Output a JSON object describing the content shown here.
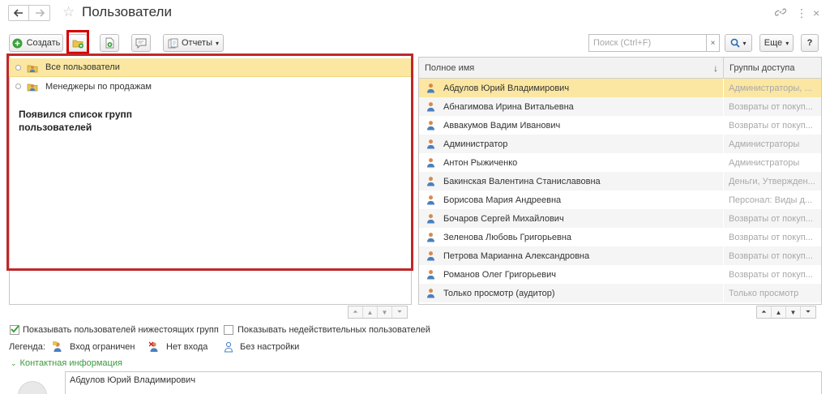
{
  "window": {
    "title": "Пользователи"
  },
  "toolbar": {
    "create_label": "Создать",
    "reports_label": "Отчеты",
    "search_placeholder": "Поиск (Ctrl+F)",
    "search_clear": "×",
    "more_label": "Еще",
    "help_label": "?"
  },
  "groups_panel": {
    "items": [
      {
        "label": "Все пользователи",
        "selected": true
      },
      {
        "label": "Менеджеры по продажам",
        "selected": false
      }
    ],
    "annotation": "Появился список групп пользователей"
  },
  "users_table": {
    "columns": {
      "name": "Полное имя",
      "groups": "Группы доступа",
      "sort_indicator": "↓"
    },
    "rows": [
      {
        "name": "Абдулов Юрий Владимирович",
        "groups": "Администраторы, ..."
      },
      {
        "name": "Абнагимова Ирина Витальевна",
        "groups": "Возвраты от покуп..."
      },
      {
        "name": "Аввакумов Вадим Иванович",
        "groups": "Возвраты от покуп..."
      },
      {
        "name": "Администратор",
        "groups": "Администраторы"
      },
      {
        "name": "Антон Рыжиченко",
        "groups": "Администраторы"
      },
      {
        "name": "Бакинская Валентина Станиславовна",
        "groups": "Деньги, Утвержден..."
      },
      {
        "name": "Борисова Мария Андреевна",
        "groups": "Персонал: Виды д..."
      },
      {
        "name": "Бочаров Сергей Михайлович",
        "groups": "Возвраты от покуп..."
      },
      {
        "name": "Зеленова Любовь Григорьевна",
        "groups": "Возвраты от покуп..."
      },
      {
        "name": "Петрова Марианна Александровна",
        "groups": "Возвраты от покуп..."
      },
      {
        "name": "Романов Олег Григорьевич",
        "groups": "Возвраты от покуп..."
      },
      {
        "name": "Только просмотр (аудитор)",
        "groups": "Только просмотр"
      }
    ]
  },
  "options": {
    "show_subgroup_users": {
      "label": "Показывать пользователей нижестоящих групп",
      "checked": true
    },
    "show_invalid_users": {
      "label": "Показывать недействительных пользователей",
      "checked": false
    }
  },
  "legend": {
    "title": "Легенда:",
    "items": [
      "Вход ограничен",
      "Нет входа",
      "Без настройки"
    ]
  },
  "contact": {
    "section_label": "Контактная информация",
    "value": "Абдулов Юрий Владимирович"
  },
  "colors": {
    "accent_green": "#3c9a3c",
    "selection": "#fbe7a1",
    "highlight_red": "#c0282a"
  }
}
